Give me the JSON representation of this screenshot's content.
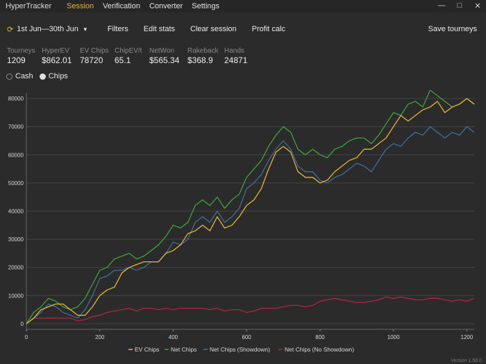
{
  "app": {
    "title": "HyperTracker"
  },
  "menu": [
    {
      "label": "Session",
      "active": true
    },
    {
      "label": "Verification",
      "active": false
    },
    {
      "label": "Converter",
      "active": false
    },
    {
      "label": "Settings",
      "active": false
    }
  ],
  "window_controls": {
    "minimize": "—",
    "maximize": "□",
    "close": "✕"
  },
  "toolbar": {
    "date_range": "1st Jun—30th Jun",
    "filters": "Filters",
    "edit_stats": "Edit stats",
    "clear_session": "Clear session",
    "profit_calc": "Profit calc",
    "save_tourneys": "Save tourneys"
  },
  "stats": [
    {
      "label": "Tourneys",
      "value": "1209"
    },
    {
      "label": "HyperEV",
      "value": "$862.01"
    },
    {
      "label": "EV Chips",
      "value": "78720"
    },
    {
      "label": "ChipEV/t",
      "value": "65.1"
    },
    {
      "label": "NetWon",
      "value": "$565.34"
    },
    {
      "label": "Rakeback",
      "value": "$368.9"
    },
    {
      "label": "Hands",
      "value": "24871"
    }
  ],
  "view_toggle": {
    "cash": "Cash",
    "chips": "Chips",
    "selected": "chips"
  },
  "version": "Version 1.58.0",
  "chart_data": {
    "type": "line",
    "x_ticks": [
      0,
      200,
      400,
      600,
      800,
      1000,
      1200
    ],
    "y_ticks": [
      0,
      10000,
      20000,
      30000,
      40000,
      50000,
      60000,
      70000,
      80000
    ],
    "xlim": [
      0,
      1220
    ],
    "ylim": [
      -2000,
      82000
    ],
    "grid": true,
    "legend_position": "bottom",
    "series": [
      {
        "name": "EV Chips",
        "color": "#e8b530",
        "x": [
          0,
          20,
          40,
          60,
          80,
          100,
          120,
          140,
          160,
          180,
          200,
          220,
          240,
          260,
          280,
          300,
          320,
          340,
          360,
          380,
          400,
          420,
          440,
          460,
          480,
          500,
          520,
          540,
          560,
          580,
          600,
          620,
          640,
          660,
          680,
          700,
          720,
          740,
          760,
          780,
          800,
          820,
          840,
          860,
          880,
          900,
          920,
          940,
          960,
          980,
          1000,
          1020,
          1040,
          1060,
          1080,
          1100,
          1120,
          1140,
          1160,
          1180,
          1200,
          1220
        ],
        "y": [
          0,
          2000,
          5000,
          6000,
          7000,
          7000,
          5000,
          3000,
          3000,
          6000,
          10000,
          12000,
          13000,
          18000,
          20000,
          21000,
          22000,
          22000,
          22000,
          25000,
          26000,
          28000,
          32000,
          33000,
          35000,
          33000,
          38000,
          34000,
          35000,
          38000,
          42000,
          44000,
          48000,
          55000,
          61000,
          63000,
          61000,
          54000,
          52000,
          52000,
          50000,
          51000,
          54000,
          56000,
          58000,
          59000,
          62000,
          62000,
          64000,
          66000,
          70000,
          74000,
          72000,
          74000,
          76000,
          77000,
          79000,
          75000,
          77000,
          78000,
          80000,
          78000
        ]
      },
      {
        "name": "Net Chips",
        "color": "#3aa63a",
        "x": [
          0,
          20,
          40,
          60,
          80,
          100,
          120,
          140,
          160,
          180,
          200,
          220,
          240,
          260,
          280,
          300,
          320,
          340,
          360,
          380,
          400,
          420,
          440,
          460,
          480,
          500,
          520,
          540,
          560,
          580,
          600,
          620,
          640,
          660,
          680,
          700,
          720,
          740,
          760,
          780,
          800,
          820,
          840,
          860,
          880,
          900,
          920,
          940,
          960,
          980,
          1000,
          1020,
          1040,
          1060,
          1080,
          1100,
          1120,
          1140,
          1160,
          1180,
          1200,
          1220
        ],
        "y": [
          0,
          4000,
          6000,
          9000,
          8000,
          6000,
          5000,
          6000,
          9000,
          14000,
          19000,
          20000,
          23000,
          24000,
          25000,
          23000,
          24000,
          26000,
          28000,
          31000,
          35000,
          34000,
          36000,
          42000,
          44000,
          42000,
          45000,
          41000,
          44000,
          46000,
          52000,
          55000,
          58000,
          63000,
          67000,
          70000,
          68000,
          62000,
          60000,
          62000,
          60000,
          59000,
          62000,
          63000,
          65000,
          66000,
          66000,
          64000,
          67000,
          71000,
          75000,
          74000,
          78000,
          79000,
          77000,
          83000,
          81000,
          79000,
          77000,
          78000,
          80000,
          78000
        ]
      },
      {
        "name": "Net Chips (Showdown)",
        "color": "#3f6f96",
        "x": [
          0,
          20,
          40,
          60,
          80,
          100,
          120,
          140,
          160,
          180,
          200,
          220,
          240,
          260,
          280,
          300,
          320,
          340,
          360,
          380,
          400,
          420,
          440,
          460,
          480,
          500,
          520,
          540,
          560,
          580,
          600,
          620,
          640,
          660,
          680,
          700,
          720,
          740,
          760,
          780,
          800,
          820,
          840,
          860,
          880,
          900,
          920,
          940,
          960,
          980,
          1000,
          1020,
          1040,
          1060,
          1080,
          1100,
          1120,
          1140,
          1160,
          1180,
          1200,
          1220
        ],
        "y": [
          0,
          2000,
          4000,
          7000,
          6000,
          4000,
          3000,
          2000,
          5000,
          10000,
          16000,
          17000,
          19000,
          19000,
          20000,
          19000,
          20000,
          22000,
          22000,
          25000,
          29000,
          28000,
          30000,
          36000,
          38000,
          36000,
          40000,
          36000,
          38000,
          41000,
          48000,
          50000,
          53000,
          58000,
          62000,
          65000,
          62000,
          56000,
          54000,
          54000,
          51000,
          50000,
          52000,
          53000,
          55000,
          57000,
          56000,
          54000,
          58000,
          62000,
          64000,
          63000,
          66000,
          68000,
          67000,
          70000,
          68000,
          66000,
          68000,
          67000,
          70000,
          68000
        ]
      },
      {
        "name": "Net Chips (No Showdown)",
        "color": "#b3243d",
        "x": [
          0,
          20,
          40,
          60,
          80,
          100,
          120,
          140,
          160,
          180,
          200,
          220,
          240,
          260,
          280,
          300,
          320,
          340,
          360,
          380,
          400,
          420,
          440,
          460,
          480,
          500,
          520,
          540,
          560,
          580,
          600,
          620,
          640,
          660,
          680,
          700,
          720,
          740,
          760,
          780,
          800,
          820,
          840,
          860,
          880,
          900,
          920,
          940,
          960,
          980,
          1000,
          1020,
          1040,
          1060,
          1080,
          1100,
          1120,
          1140,
          1160,
          1180,
          1200,
          1220
        ],
        "y": [
          0,
          2000,
          2000,
          2000,
          2000,
          2000,
          2000,
          1000,
          1500,
          2500,
          3000,
          4000,
          4500,
          5000,
          5500,
          4500,
          5500,
          5500,
          5000,
          5500,
          5000,
          5500,
          5500,
          5500,
          5500,
          5000,
          5500,
          4500,
          5000,
          5000,
          4000,
          4500,
          5500,
          5500,
          5500,
          6000,
          6500,
          6500,
          6000,
          6500,
          8000,
          8500,
          9000,
          8500,
          8000,
          7500,
          7500,
          8000,
          8500,
          9500,
          9000,
          9500,
          9000,
          8500,
          8500,
          9000,
          9000,
          8500,
          8000,
          8500,
          8000,
          9000
        ]
      }
    ]
  }
}
